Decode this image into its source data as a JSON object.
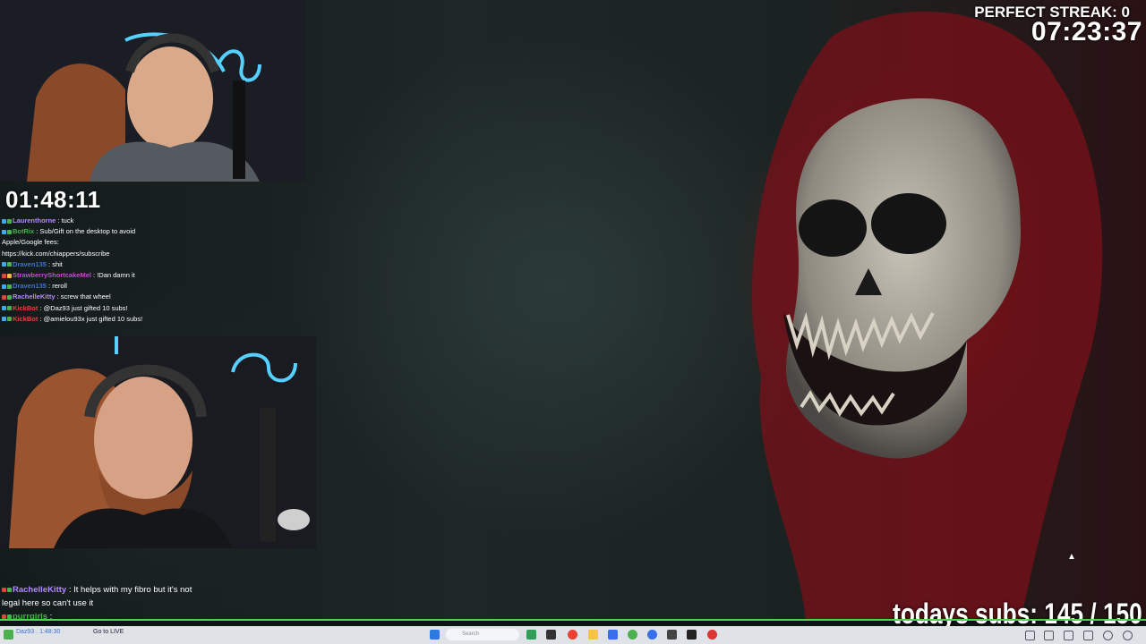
{
  "overlay": {
    "streak_label": "PERFECT STREAK: 0",
    "stream_clock": "07:23:37",
    "small_timer": "01:48:11",
    "subs_label": "todays subs:",
    "subs_value": "145 / 150"
  },
  "chat_top": [
    {
      "user": "Laurenthorne",
      "msg": " : tuck",
      "color": "#b388ff"
    },
    {
      "user": "BotRix",
      "msg": " : Sub/Gift on the desktop to avoid",
      "color": "#4caf50"
    },
    {
      "user": "",
      "msg": "Apple/Google fees:",
      "color": "#ffffff"
    },
    {
      "user": "",
      "msg": "https://kick.com/chiappers/subscribe",
      "color": "#ffffff"
    },
    {
      "user": "Draven135",
      "msg": " : shit",
      "color": "#3f6fd8"
    },
    {
      "user": "StrawberryShortcakeMel",
      "msg": " : !Dan damn it",
      "color": "#c54bd6"
    },
    {
      "user": "Draven135",
      "msg": " : reroll",
      "color": "#3f6fd8"
    },
    {
      "user": "RachelleKitty",
      "msg": " : screw that wheel",
      "color": "#b388ff"
    },
    {
      "user": "KickBot",
      "msg": " : @Daz93 just gifted 10 subs!",
      "color": "#e0443a"
    },
    {
      "user": "KickBot",
      "msg": " : @amielou93x just gifted 10 subs!",
      "color": "#e0443a"
    }
  ],
  "chat_bottom": [
    {
      "user": "RachelleKitty",
      "msg": " : It helps with my fibro but it's not",
      "color": "#b388ff"
    },
    {
      "user": "",
      "msg": "legal here so can't use it",
      "color": "#ffffff"
    },
    {
      "user": "purrgirls",
      "msg": " :",
      "color": "#4caf50"
    }
  ],
  "taskbar": {
    "time_text": "Daz93 . 1:48:30",
    "live_label": "Go to LIVE",
    "search_placeholder": "Search"
  },
  "colors": {
    "accent_green": "#46d84a",
    "blood_red": "#8c1420"
  }
}
